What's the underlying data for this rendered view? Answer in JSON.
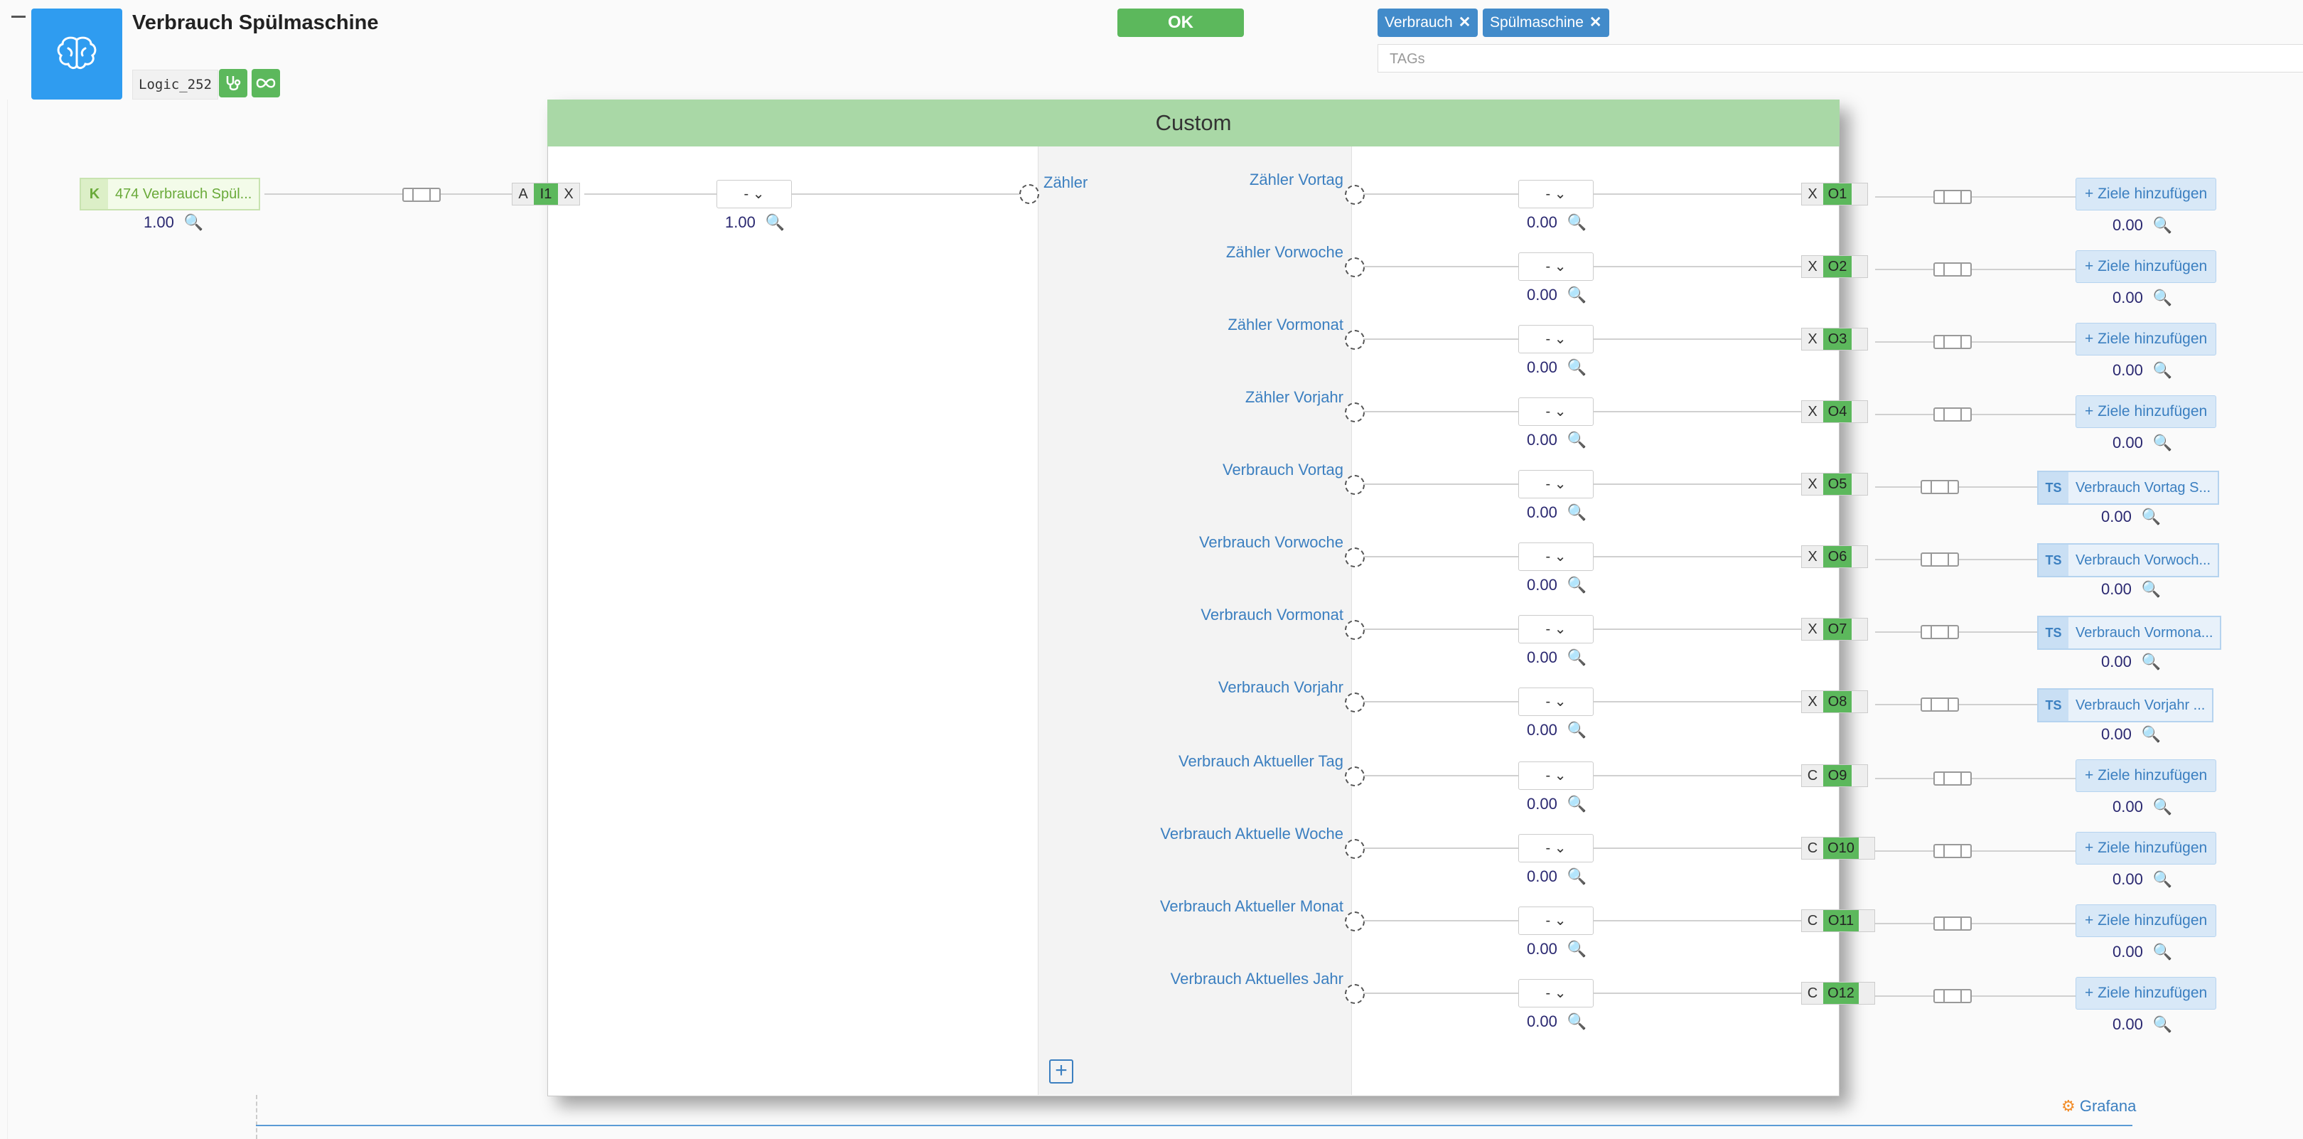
{
  "header": {
    "title": "Verbrauch Spülmaschine",
    "logic_id": "Logic_252",
    "ok_label": "OK",
    "tags": [
      {
        "label": "Verbrauch",
        "remove": "✕"
      },
      {
        "label": "Spülmaschine",
        "remove": "✕"
      }
    ],
    "tags_placeholder": "TAGs",
    "brain_icon": "brain-icon",
    "stethoscope_icon": "stethoscope-icon",
    "infinity_icon": "infinity-icon"
  },
  "block": {
    "title": "Custom",
    "input_label": "Zähler",
    "add_icon": "plus-square-icon"
  },
  "input": {
    "source_prefix": "K",
    "source_label": "474 Verbrauch Spül...",
    "source_value": "1.00",
    "port_mode": "A",
    "port_id": "I1",
    "port_flag": "X",
    "select_value": "-",
    "select_chevron": "⌄",
    "value": "1.00",
    "mag_color": "#f2a07b"
  },
  "outputs": [
    {
      "label": "Zähler Vortag",
      "mode": "X",
      "port": "O1",
      "value": "0.00",
      "mag_color": "#e0245e",
      "target_type": "ziele",
      "target_label": "+ Ziele hinzufügen",
      "target_value": "0.00",
      "target_mag_color": "#e0245e"
    },
    {
      "label": "Zähler Vorwoche",
      "mode": "X",
      "port": "O2",
      "value": "0.00",
      "mag_color": "#e0322a",
      "target_type": "ziele",
      "target_label": "+ Ziele hinzufügen",
      "target_value": "0.00",
      "target_mag_color": "#e0322a"
    },
    {
      "label": "Zähler Vormonat",
      "mode": "X",
      "port": "O3",
      "value": "0.00",
      "mag_color": "#34d6c8",
      "target_type": "ziele",
      "target_label": "+ Ziele hinzufügen",
      "target_value": "0.00",
      "target_mag_color": "#34d6c8"
    },
    {
      "label": "Zähler Vorjahr",
      "mode": "X",
      "port": "O4",
      "value": "0.00",
      "mag_color": "#4aa34a",
      "target_type": "ziele",
      "target_label": "+ Ziele hinzufügen",
      "target_value": "0.00",
      "target_mag_color": "#4aa34a"
    },
    {
      "label": "Verbrauch Vortag",
      "mode": "X",
      "port": "O5",
      "value": "0.00",
      "mag_color": "#9b5fc0",
      "target_type": "ts",
      "target_prefix": "TS",
      "target_label": "Verbrauch Vortag S...",
      "target_value": "0.00",
      "target_mag_color": "#9b5fc0"
    },
    {
      "label": "Verbrauch Vorwoche",
      "mode": "X",
      "port": "O6",
      "value": "0.00",
      "mag_color": "#2e8b2e",
      "target_type": "ts",
      "target_prefix": "TS",
      "target_label": "Verbrauch Vorwoch...",
      "target_value": "0.00",
      "target_mag_color": "#2e8b2e"
    },
    {
      "label": "Verbrauch Vormonat",
      "mode": "X",
      "port": "O7",
      "value": "0.00",
      "mag_color": "#c0392b",
      "target_type": "ts",
      "target_prefix": "TS",
      "target_label": "Verbrauch Vormona...",
      "target_value": "0.00",
      "target_mag_color": "#c0392b"
    },
    {
      "label": "Verbrauch Vorjahr",
      "mode": "X",
      "port": "O8",
      "value": "0.00",
      "mag_color": "#c77dd1",
      "target_type": "ts",
      "target_prefix": "TS",
      "target_label": "Verbrauch Vorjahr ...",
      "target_value": "0.00",
      "target_mag_color": "#c77dd1"
    },
    {
      "label": "Verbrauch Aktueller Tag",
      "mode": "C",
      "port": "O9",
      "value": "0.00",
      "mag_color": "#555555",
      "target_type": "ziele",
      "target_label": "+ Ziele hinzufügen",
      "target_value": "0.00",
      "target_mag_color": "#555555"
    },
    {
      "label": "Verbrauch Aktuelle Woche",
      "mode": "C",
      "port": "O10",
      "value": "0.00",
      "mag_color": "#8e24aa",
      "target_type": "ziele",
      "target_label": "+ Ziele hinzufügen",
      "target_value": "0.00",
      "target_mag_color": "#8e24aa"
    },
    {
      "label": "Verbrauch Aktueller Monat",
      "mode": "C",
      "port": "O11",
      "value": "0.00",
      "mag_color": "#d580d8",
      "target_type": "ziele",
      "target_label": "+ Ziele hinzufügen",
      "target_value": "0.00",
      "target_mag_color": "#d580d8"
    },
    {
      "label": "Verbrauch Aktuelles Jahr",
      "mode": "C",
      "port": "O12",
      "value": "0.00",
      "mag_color": "#2a9fd6",
      "target_type": "ziele",
      "target_label": "+ Ziele hinzufügen",
      "target_value": "0.00",
      "target_mag_color": "#2a9fd6"
    }
  ],
  "footer": {
    "grafana_label": "Grafana",
    "grafana_icon": "grafana-icon"
  },
  "colors": {
    "accent_blue": "#2f9cf0",
    "ok_green": "#5cb85c",
    "tag_blue": "#428bca",
    "header_green": "#a9d8a6"
  }
}
